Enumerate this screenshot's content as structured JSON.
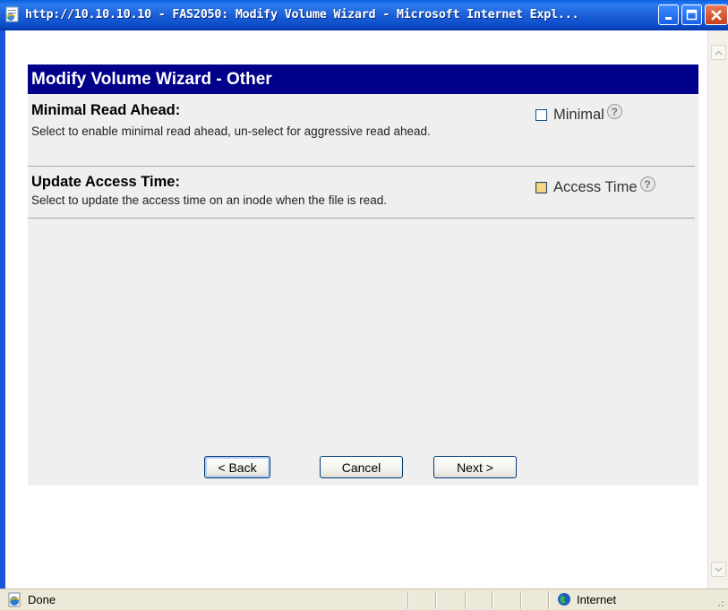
{
  "window": {
    "title": "http://10.10.10.10 - FAS2050: Modify Volume Wizard - Microsoft Internet Expl...",
    "min_icon": "minimize-icon",
    "max_icon": "maximize-icon",
    "close_icon": "close-icon"
  },
  "wizard": {
    "header": "Modify Volume Wizard - Other",
    "options": [
      {
        "title": "Minimal Read Ahead:",
        "description": "Select to enable minimal read ahead, un-select for aggressive read ahead.",
        "checkbox_label": "Minimal",
        "checked": false,
        "help": "?"
      },
      {
        "title": "Update Access Time:",
        "description": "Select to update the access time on an inode when the file is read.",
        "checkbox_label": "Access Time",
        "checked": false,
        "help": "?"
      }
    ],
    "buttons": {
      "back": "< Back",
      "cancel": "Cancel",
      "next": "Next >"
    }
  },
  "statusbar": {
    "status": "Done",
    "zone": "Internet"
  },
  "colors": {
    "header_bg": "#00008a",
    "panel_bg": "#efefef",
    "titlebar": "#1c60d8"
  }
}
